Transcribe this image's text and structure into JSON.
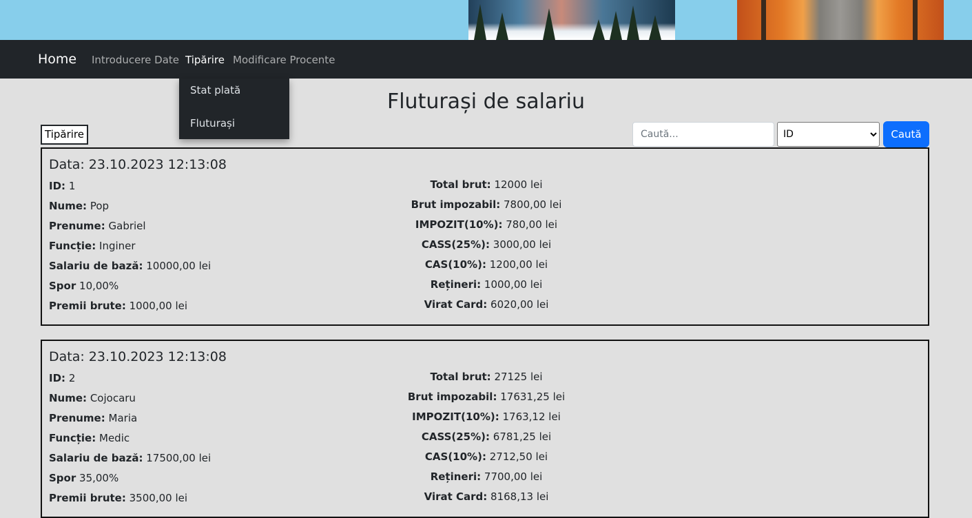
{
  "nav": {
    "brand": "Home",
    "items": [
      {
        "label": "Introducere Date",
        "active": false
      },
      {
        "label": "Tipărire",
        "active": true
      },
      {
        "label": "Modificare Procente",
        "active": false
      }
    ],
    "dropdown": [
      "Stat plată",
      "Fluturași"
    ]
  },
  "page": {
    "title": "Fluturași de salariu",
    "print_label": "Tipărire",
    "search_placeholder": "Caută...",
    "search_select_value": "ID",
    "search_button_label": "Caută"
  },
  "cards": [
    {
      "date": "Data: 23.10.2023 12:13:08",
      "left": [
        {
          "label": "ID:",
          "value": "1"
        },
        {
          "label": "Nume:",
          "value": "Pop"
        },
        {
          "label": "Prenume:",
          "value": "Gabriel"
        },
        {
          "label": "Funcție:",
          "value": "Inginer"
        },
        {
          "label": "Salariu de bază:",
          "value": "10000,00 lei"
        },
        {
          "label": "Spor",
          "value": "10,00%"
        },
        {
          "label": "Premii brute:",
          "value": "1000,00 lei"
        }
      ],
      "right": [
        {
          "label": "Total brut:",
          "value": "12000 lei"
        },
        {
          "label": "Brut impozabil:",
          "value": "7800,00 lei"
        },
        {
          "label": "IMPOZIT(10%):",
          "value": "780,00 lei"
        },
        {
          "label": "CASS(25%):",
          "value": "3000,00 lei"
        },
        {
          "label": "CAS(10%):",
          "value": "1200,00 lei"
        },
        {
          "label": "Rețineri:",
          "value": "1000,00 lei"
        },
        {
          "label": "Virat Card:",
          "value": "6020,00 lei"
        }
      ]
    },
    {
      "date": "Data: 23.10.2023 12:13:08",
      "left": [
        {
          "label": "ID:",
          "value": "2"
        },
        {
          "label": "Nume:",
          "value": "Cojocaru"
        },
        {
          "label": "Prenume:",
          "value": "Maria"
        },
        {
          "label": "Funcție:",
          "value": "Medic"
        },
        {
          "label": "Salariu de bază:",
          "value": "17500,00 lei"
        },
        {
          "label": "Spor",
          "value": "35,00%"
        },
        {
          "label": "Premii brute:",
          "value": "3500,00 lei"
        }
      ],
      "right": [
        {
          "label": "Total brut:",
          "value": "27125 lei"
        },
        {
          "label": "Brut impozabil:",
          "value": "17631,25 lei"
        },
        {
          "label": "IMPOZIT(10%):",
          "value": "1763,12 lei"
        },
        {
          "label": "CASS(25%):",
          "value": "6781,25 lei"
        },
        {
          "label": "CAS(10%):",
          "value": "2712,50 lei"
        },
        {
          "label": "Rețineri:",
          "value": "7700,00 lei"
        },
        {
          "label": "Virat Card:",
          "value": "8168,13 lei"
        }
      ]
    }
  ]
}
